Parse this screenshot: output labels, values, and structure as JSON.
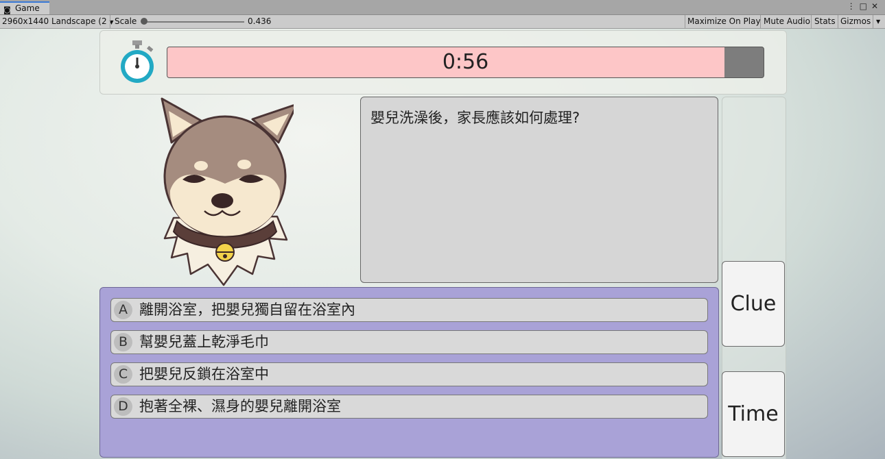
{
  "editor": {
    "tab_title": "Game",
    "tab_icon": "gamepad-icon",
    "resolution": "2960x1440 Landscape (2",
    "scale_label": "Scale",
    "scale_value": "0.436",
    "maximize_on_play": "Maximize On Play",
    "mute_audio": "Mute Audio",
    "stats": "Stats",
    "gizmos": "Gizmos"
  },
  "timer": {
    "text": "0:56",
    "fill_fraction": 0.934,
    "fill_color": "#fdc6c7",
    "track_color": "#7d7d7d",
    "icon": "stopwatch-icon"
  },
  "question": {
    "text": "嬰兒洗澡後，家長應該如何處理?"
  },
  "answers": [
    {
      "letter": "A",
      "text": "離開浴室，把嬰兒獨自留在浴室內"
    },
    {
      "letter": "B",
      "text": "幫嬰兒蓋上乾淨毛巾"
    },
    {
      "letter": "C",
      "text": "把嬰兒反鎖在浴室中"
    },
    {
      "letter": "D",
      "text": "抱著全裸、濕身的嬰兒離開浴室"
    }
  ],
  "buttons": {
    "clue": "Clue",
    "time": "Time"
  },
  "colors": {
    "answers_panel": "#a9a2d7",
    "question_box": "#d6d6d6"
  }
}
